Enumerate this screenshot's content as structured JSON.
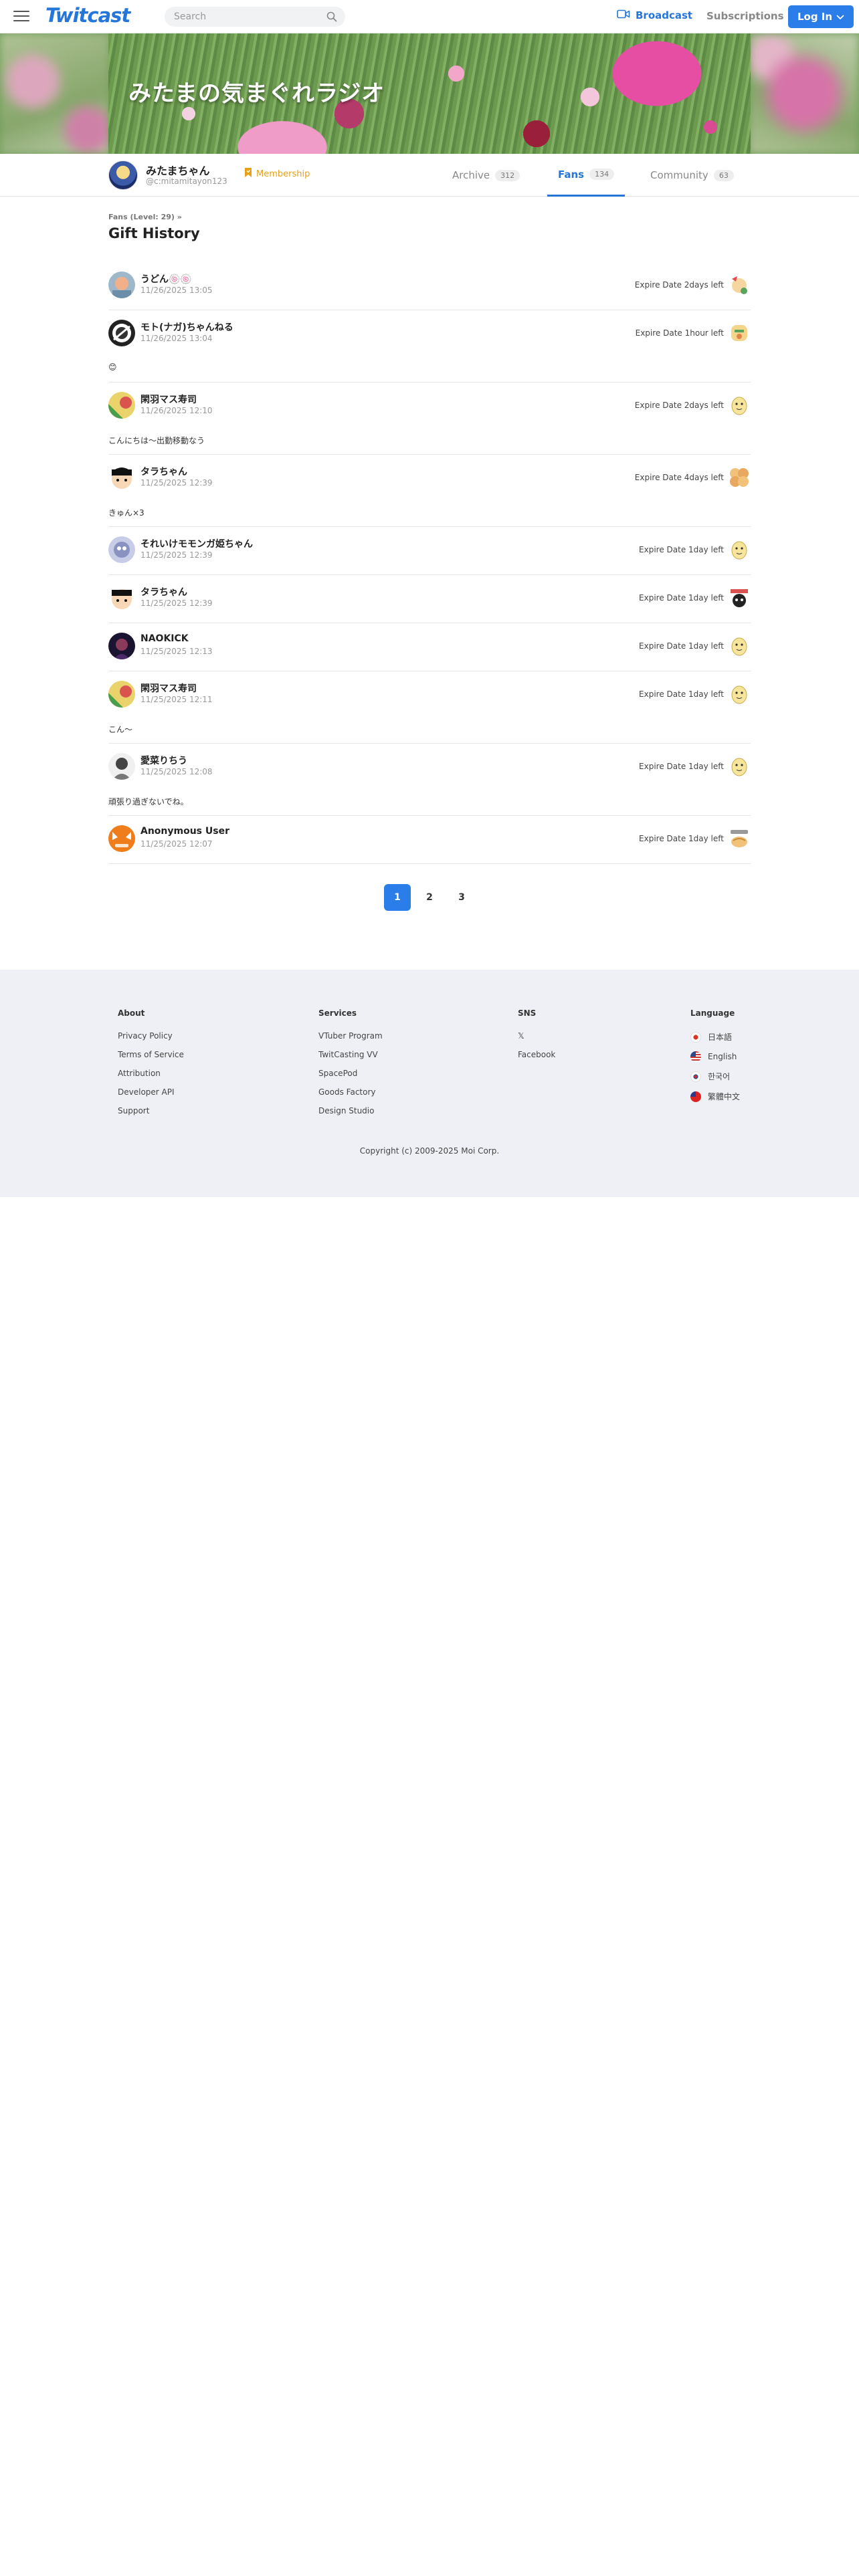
{
  "header": {
    "logo": "Twitcast",
    "search_placeholder": "Search",
    "broadcast_label": "Broadcast",
    "subscriptions_label": "Subscriptions",
    "login_label": "Log In"
  },
  "banner": {
    "title": "みたまの気まぐれラジオ"
  },
  "profile": {
    "name": "みたまちゃん",
    "id": "@c:mitamitayon123",
    "membership_label": "Membership",
    "tabs": [
      {
        "label": "Archive",
        "count": "312"
      },
      {
        "label": "Fans",
        "count": "134"
      },
      {
        "label": "Community",
        "count": "63"
      }
    ]
  },
  "breadcrumb": "Fans (Level: 29)  »",
  "page_title": "Gift History",
  "gifts": [
    {
      "user": "うどん🍥🍥",
      "time": "11/26/2025 13:05",
      "expire": "Expire Date 2days left",
      "message": ""
    },
    {
      "user": "モト(ナガ)ちゃんねる",
      "time": "11/26/2025 13:04",
      "expire": "Expire Date 1hour left",
      "message": "😊"
    },
    {
      "user": "閑羽マス寿司",
      "time": "11/26/2025 12:10",
      "expire": "Expire Date 2days left",
      "message": "こんにちは〜出勤移動なう"
    },
    {
      "user": "タラちゃん",
      "time": "11/25/2025 12:39",
      "expire": "Expire Date 4days left",
      "message": "きゅん×3"
    },
    {
      "user": "それいけモモンガ姫ちゃん",
      "time": "11/25/2025 12:39",
      "expire": "Expire Date 1day left",
      "message": ""
    },
    {
      "user": "タラちゃん",
      "time": "11/25/2025 12:39",
      "expire": "Expire Date 1day left",
      "message": ""
    },
    {
      "user": "NAOKICK",
      "time": "11/25/2025 12:13",
      "expire": "Expire Date 1day left",
      "message": ""
    },
    {
      "user": "閑羽マス寿司",
      "time": "11/25/2025 12:11",
      "expire": "Expire Date 1day left",
      "message": "こん〜"
    },
    {
      "user": "愛菜りちう",
      "time": "11/25/2025 12:08",
      "expire": "Expire Date 1day left",
      "message": "頑張り過ぎないでね。"
    },
    {
      "user": "Anonymous User",
      "time": "11/25/2025 12:07",
      "expire": "Expire Date 1day left",
      "message": ""
    }
  ],
  "pagination": [
    "1",
    "2",
    "3"
  ],
  "footer": {
    "about": {
      "title": "About",
      "links": [
        "Privacy Policy",
        "Terms of Service",
        "Attribution",
        "Developer API",
        "Support"
      ]
    },
    "services": {
      "title": "Services",
      "links": [
        "VTuber Program",
        "TwitCasting VV",
        "SpacePod",
        "Goods Factory",
        "Design Studio"
      ]
    },
    "sns": {
      "title": "SNS",
      "links": [
        "𝕏",
        "Facebook"
      ]
    },
    "language": {
      "title": "Language",
      "links": [
        "日本語",
        "English",
        "한국어",
        "繁體中文"
      ]
    },
    "copyright": "Copyright (c) 2009-2025 Moi Corp."
  },
  "colors": {
    "accent": "#2675d9",
    "membership": "#e7a017",
    "footer_bg": "#eef0f5"
  }
}
